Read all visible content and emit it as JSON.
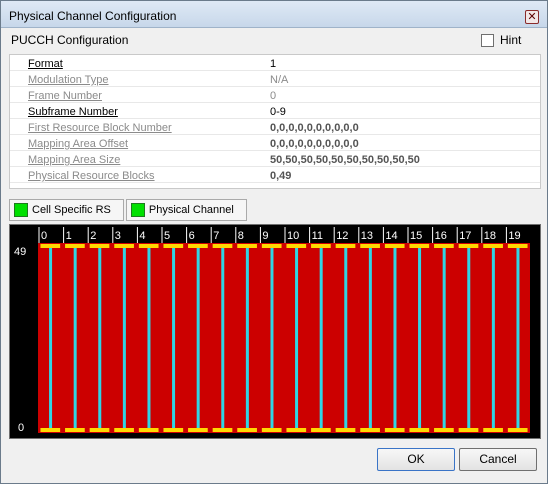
{
  "window": {
    "title": "Physical Channel Configuration",
    "close_icon": "close-icon"
  },
  "panel": {
    "title": "PUCCH Configuration",
    "hint_label": "Hint",
    "hint_checked": false
  },
  "properties": [
    {
      "name": "Format",
      "value": "1",
      "name_enabled": true,
      "value_style": "enabled"
    },
    {
      "name": "Modulation Type",
      "value": "N/A",
      "name_enabled": false,
      "value_style": "disabled"
    },
    {
      "name": "Frame Number",
      "value": "0",
      "name_enabled": false,
      "value_style": "disabled"
    },
    {
      "name": "Subframe Number",
      "value": "0-9",
      "name_enabled": true,
      "value_style": "enabled"
    },
    {
      "name": "First Resource Block Number",
      "value": "0,0,0,0,0,0,0,0,0,0",
      "name_enabled": false,
      "value_style": "bold"
    },
    {
      "name": "Mapping Area Offset",
      "value": "0,0,0,0,0,0,0,0,0,0",
      "name_enabled": false,
      "value_style": "bold"
    },
    {
      "name": "Mapping Area Size",
      "value": "50,50,50,50,50,50,50,50,50,50",
      "name_enabled": false,
      "value_style": "bold"
    },
    {
      "name": "Physical Resource Blocks",
      "value": "0,49",
      "name_enabled": false,
      "value_style": "bold"
    }
  ],
  "legend": [
    {
      "label": "Cell Specific RS",
      "color": "#00e000"
    },
    {
      "label": "Physical Channel",
      "color": "#00e000"
    }
  ],
  "grid": {
    "slot_labels": [
      "0",
      "1",
      "2",
      "3",
      "4",
      "5",
      "6",
      "7",
      "8",
      "9",
      "10",
      "11",
      "12",
      "13",
      "14",
      "15",
      "16",
      "17",
      "18",
      "19"
    ],
    "y_top_label": "49",
    "y_bottom_label": "0",
    "colors": {
      "background": "#000000",
      "fill": "#cc0000",
      "rs_line": "#2fd5e6",
      "marker": "#ffd800"
    }
  },
  "buttons": {
    "ok": "OK",
    "cancel": "Cancel"
  }
}
